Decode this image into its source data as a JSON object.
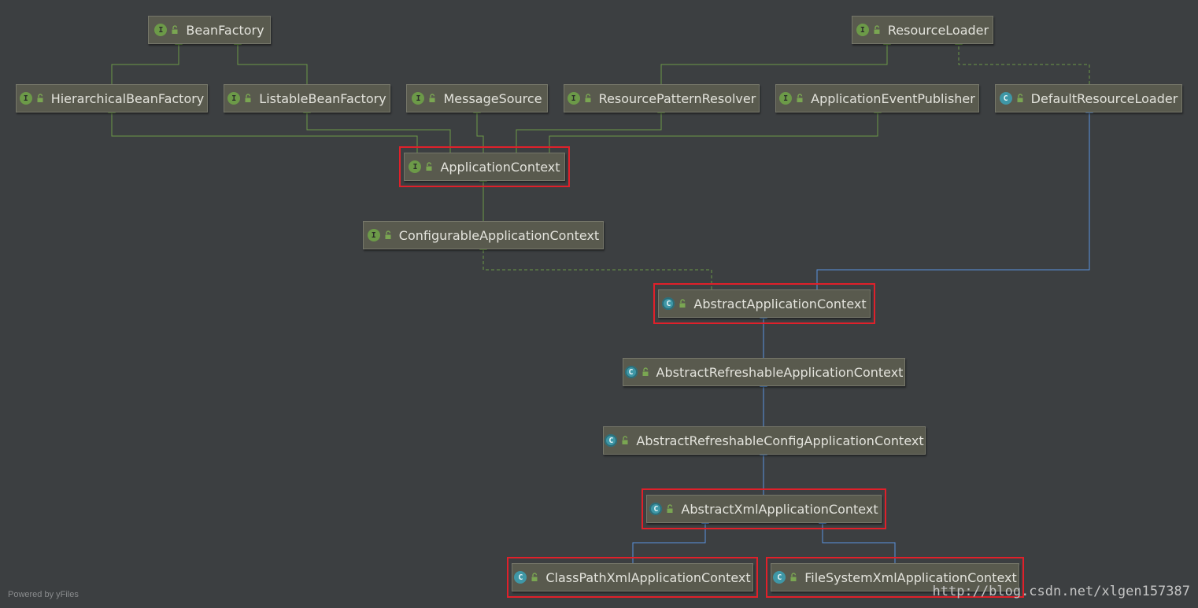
{
  "nodes": [
    {
      "id": "BeanFactory",
      "label": "BeanFactory",
      "kind": "interface",
      "badge": "I"
    },
    {
      "id": "ResourceLoader",
      "label": "ResourceLoader",
      "kind": "interface",
      "badge": "I"
    },
    {
      "id": "HierarchicalBeanFactory",
      "label": "HierarchicalBeanFactory",
      "kind": "interface",
      "badge": "I"
    },
    {
      "id": "ListableBeanFactory",
      "label": "ListableBeanFactory",
      "kind": "interface",
      "badge": "I"
    },
    {
      "id": "MessageSource",
      "label": "MessageSource",
      "kind": "interface",
      "badge": "I"
    },
    {
      "id": "ResourcePatternResolver",
      "label": "ResourcePatternResolver",
      "kind": "interface",
      "badge": "I"
    },
    {
      "id": "ApplicationEventPublisher",
      "label": "ApplicationEventPublisher",
      "kind": "interface",
      "badge": "I"
    },
    {
      "id": "DefaultResourceLoader",
      "label": "DefaultResourceLoader",
      "kind": "class",
      "badge": "C"
    },
    {
      "id": "ApplicationContext",
      "label": "ApplicationContext",
      "kind": "interface",
      "badge": "I",
      "highlighted": true
    },
    {
      "id": "ConfigurableApplicationContext",
      "label": "ConfigurableApplicationContext",
      "kind": "interface",
      "badge": "I"
    },
    {
      "id": "AbstractApplicationContext",
      "label": "AbstractApplicationContext",
      "kind": "abstract",
      "badge": "C",
      "highlighted": true
    },
    {
      "id": "AbstractRefreshableApplicationContext",
      "label": "AbstractRefreshableApplicationContext",
      "kind": "abstract",
      "badge": "C"
    },
    {
      "id": "AbstractRefreshableConfigApplicationContext",
      "label": "AbstractRefreshableConfigApplicationContext",
      "kind": "abstract",
      "badge": "C"
    },
    {
      "id": "AbstractXmlApplicationContext",
      "label": "AbstractXmlApplicationContext",
      "kind": "abstract",
      "badge": "C",
      "highlighted": true
    },
    {
      "id": "ClassPathXmlApplicationContext",
      "label": "ClassPathXmlApplicationContext",
      "kind": "class",
      "badge": "C",
      "highlighted": true
    },
    {
      "id": "FileSystemXmlApplicationContext",
      "label": "FileSystemXmlApplicationContext",
      "kind": "class",
      "badge": "C",
      "highlighted": true
    }
  ],
  "edges": [
    {
      "from": "HierarchicalBeanFactory",
      "to": "BeanFactory",
      "type": "interface-extends"
    },
    {
      "from": "ListableBeanFactory",
      "to": "BeanFactory",
      "type": "interface-extends"
    },
    {
      "from": "ResourcePatternResolver",
      "to": "ResourceLoader",
      "type": "interface-extends"
    },
    {
      "from": "DefaultResourceLoader",
      "to": "ResourceLoader",
      "type": "implements"
    },
    {
      "from": "ApplicationContext",
      "to": "HierarchicalBeanFactory",
      "type": "interface-extends"
    },
    {
      "from": "ApplicationContext",
      "to": "ListableBeanFactory",
      "type": "interface-extends"
    },
    {
      "from": "ApplicationContext",
      "to": "MessageSource",
      "type": "interface-extends"
    },
    {
      "from": "ApplicationContext",
      "to": "ResourcePatternResolver",
      "type": "interface-extends"
    },
    {
      "from": "ApplicationContext",
      "to": "ApplicationEventPublisher",
      "type": "interface-extends"
    },
    {
      "from": "ConfigurableApplicationContext",
      "to": "ApplicationContext",
      "type": "interface-extends"
    },
    {
      "from": "AbstractApplicationContext",
      "to": "ConfigurableApplicationContext",
      "type": "implements"
    },
    {
      "from": "AbstractApplicationContext",
      "to": "DefaultResourceLoader",
      "type": "class-extends"
    },
    {
      "from": "AbstractRefreshableApplicationContext",
      "to": "AbstractApplicationContext",
      "type": "class-extends"
    },
    {
      "from": "AbstractRefreshableConfigApplicationContext",
      "to": "AbstractRefreshableApplicationContext",
      "type": "class-extends"
    },
    {
      "from": "AbstractXmlApplicationContext",
      "to": "AbstractRefreshableConfigApplicationContext",
      "type": "class-extends"
    },
    {
      "from": "ClassPathXmlApplicationContext",
      "to": "AbstractXmlApplicationContext",
      "type": "class-extends"
    },
    {
      "from": "FileSystemXmlApplicationContext",
      "to": "AbstractXmlApplicationContext",
      "type": "class-extends"
    }
  ],
  "icons": {
    "visibility": "open-lock-icon"
  },
  "colors": {
    "background": "#3c3f41",
    "node_fill": "#595a4e",
    "interface_edge": "#6c9a48",
    "class_edge": "#5a93e0",
    "highlight": "#e0202a",
    "interface_badge": "#6c9a48",
    "class_badge": "#3f97a6"
  },
  "footer": "Powered by yFiles",
  "watermark": "http://blog.csdn.net/xlgen157387"
}
